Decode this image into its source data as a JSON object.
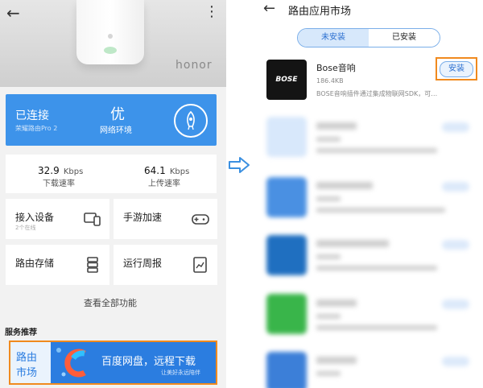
{
  "left_screen": {
    "brand_text": "honor",
    "status": {
      "connected_label": "已连接",
      "router_name": "荣耀路由Pro 2",
      "quality": "优",
      "quality_label": "网络环境"
    },
    "download": {
      "value": "32.9",
      "unit": "Kbps",
      "label": "下载速率"
    },
    "upload": {
      "value": "64.1",
      "unit": "Kbps",
      "label": "上传速率"
    },
    "tiles": {
      "devices": {
        "title": "接入设备",
        "sub": "2个在线"
      },
      "game": {
        "title": "手游加速"
      },
      "storage": {
        "title": "路由存储"
      },
      "weekly": {
        "title": "运行周报"
      }
    },
    "view_all": "查看全部功能",
    "section_title": "服务推荐",
    "banner": {
      "left_line1": "路由",
      "left_line2": "市场",
      "title": "百度网盘，远程下载",
      "subtitle": "让美好永远陪伴"
    }
  },
  "right_screen": {
    "title": "路由应用市场",
    "tabs": [
      "未安装",
      "已安装"
    ],
    "active_tab": "未安装",
    "featured_app": {
      "logo_text": "BOSE",
      "name": "Bose音响",
      "size": "186.4KB",
      "description": "BOSE音响插件通过集成物联网SDK，可…",
      "install_label": "安装"
    }
  },
  "colors": {
    "primary_blue": "#3d93ea",
    "highlight_orange": "#f08a1e",
    "tab_active_bg": "#d7e8fb"
  },
  "icons": [
    "back-arrow-icon",
    "more-icon",
    "rocket-icon",
    "devices-icon",
    "gamepad-icon",
    "storage-icon",
    "report-icon",
    "right-arrow-icon"
  ]
}
